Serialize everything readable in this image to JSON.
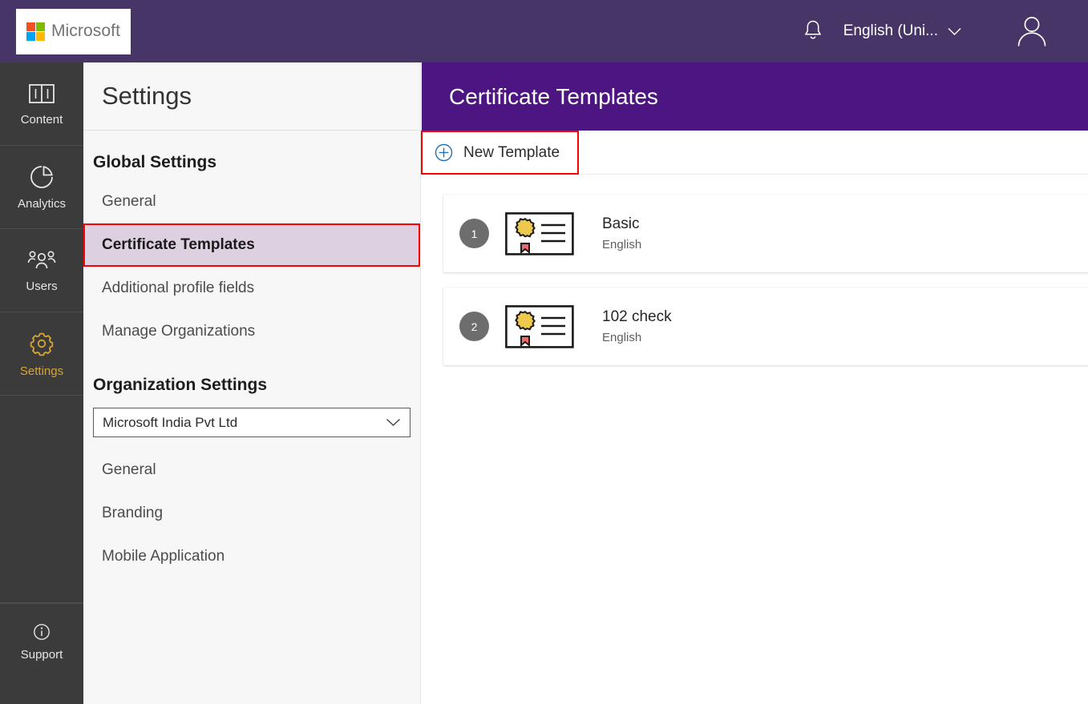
{
  "topbar": {
    "brand": "Microsoft",
    "bell_icon": "bell-icon",
    "language": "English (Uni...",
    "chevron_icon": "chevron-down-icon",
    "avatar_icon": "user-avatar-icon",
    "bg_color": "#463566"
  },
  "rail": {
    "items": [
      {
        "label": "Content",
        "icon": "book-icon",
        "active": false
      },
      {
        "label": "Analytics",
        "icon": "pie-chart-icon",
        "active": false
      },
      {
        "label": "Users",
        "icon": "people-icon",
        "active": false
      },
      {
        "label": "Settings",
        "icon": "gear-icon",
        "active": true
      }
    ],
    "support": {
      "label": "Support",
      "icon": "info-icon"
    },
    "active_color": "#d8a434",
    "bg_color": "#3b3b3b"
  },
  "settings_panel": {
    "title": "Settings",
    "global": {
      "heading": "Global Settings",
      "items": [
        {
          "label": "General",
          "selected": false
        },
        {
          "label": "Certificate Templates",
          "selected": true
        },
        {
          "label": "Additional profile fields",
          "selected": false
        },
        {
          "label": "Manage Organizations",
          "selected": false
        }
      ]
    },
    "organization": {
      "heading": "Organization Settings",
      "select": {
        "value": "Microsoft India Pvt Ltd",
        "chevron_icon": "chevron-down-icon"
      },
      "items": [
        {
          "label": "General",
          "selected": false
        },
        {
          "label": "Branding",
          "selected": false
        },
        {
          "label": "Mobile Application",
          "selected": false
        }
      ]
    },
    "selected_bg": "#ddd0e0",
    "highlight_color": "#ff0000"
  },
  "main": {
    "header_title": "Certificate Templates",
    "header_bg": "#4d1582",
    "toolbar": {
      "new_template_label": "New Template",
      "plus_icon": "plus-circle-icon"
    },
    "templates": [
      {
        "number": "1",
        "title": "Basic",
        "language": "English",
        "icon": "certificate-icon"
      },
      {
        "number": "2",
        "title": "102 check",
        "language": "English",
        "icon": "certificate-icon"
      }
    ]
  }
}
